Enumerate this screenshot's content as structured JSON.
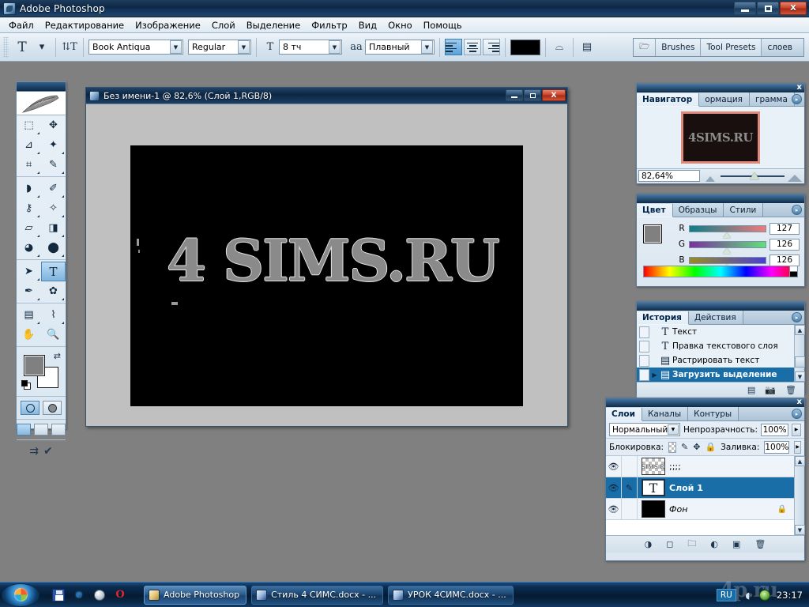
{
  "app": {
    "title": "Adobe Photoshop",
    "icon": "photoshop-icon"
  },
  "window_buttons": {
    "minimize": "minimize-icon",
    "restore": "restore-icon",
    "close": "X"
  },
  "menubar": {
    "items": [
      "Файл",
      "Редактирование",
      "Изображение",
      "Слой",
      "Выделение",
      "Фильтр",
      "Вид",
      "Окно",
      "Помощь"
    ]
  },
  "options_bar": {
    "tool_glyph": "T",
    "tool_preset_arrow": "▾",
    "orientation_icon": "text-orientation-icon",
    "font_family": "Book Antiqua",
    "font_style": "Regular",
    "size_icon": "font-size-icon",
    "font_size": "8 тч",
    "aa_icon": "anti-alias-icon",
    "anti_alias": "Плавный",
    "align": {
      "left": "align-left",
      "center": "align-center",
      "right": "align-right",
      "active": "left"
    },
    "text_color": "#000000",
    "warp_icon": "warp-text-icon",
    "panels_icon": "character-panel-icon",
    "palette_well": {
      "dock_icon": "file-browser-icon",
      "tabs": [
        "Brushes",
        "Tool Presets",
        "слоев"
      ]
    }
  },
  "toolbox": {
    "logo": "feather-logo",
    "tools": [
      {
        "name": "rectangular-marquee",
        "glyph": "⬚",
        "submenu": false
      },
      {
        "name": "move-tool",
        "glyph": "➤",
        "submenu": false
      },
      {
        "name": "lasso-tool",
        "glyph": "◁",
        "submenu": true
      },
      {
        "name": "magic-wand",
        "glyph": "✳",
        "submenu": true
      },
      {
        "name": "crop-tool",
        "glyph": "⌗",
        "submenu": true
      },
      {
        "name": "slice-tool",
        "glyph": "✎",
        "submenu": true
      },
      {
        "name": "healing-brush",
        "glyph": "✚",
        "submenu": true
      },
      {
        "name": "brush-tool",
        "glyph": "✒",
        "submenu": true
      },
      {
        "name": "clone-stamp",
        "glyph": "♆",
        "submenu": true
      },
      {
        "name": "history-brush",
        "glyph": "✧",
        "submenu": true
      },
      {
        "name": "eraser-tool",
        "glyph": "▰",
        "submenu": true
      },
      {
        "name": "gradient-tool",
        "glyph": "◨",
        "submenu": true
      },
      {
        "name": "blur-tool",
        "glyph": "💧",
        "submenu": true
      },
      {
        "name": "dodge-tool",
        "glyph": "●",
        "submenu": true
      },
      {
        "name": "path-selection",
        "glyph": "➤",
        "submenu": true
      },
      {
        "name": "type-tool",
        "glyph": "T",
        "submenu": true,
        "selected": true
      },
      {
        "name": "pen-tool",
        "glyph": "✑",
        "submenu": true
      },
      {
        "name": "custom-shape",
        "glyph": "✦",
        "submenu": true
      },
      {
        "name": "notes-tool",
        "glyph": "▤",
        "submenu": true
      },
      {
        "name": "eyedropper-tool",
        "glyph": "⌁",
        "submenu": true
      },
      {
        "name": "hand-tool",
        "glyph": "✋",
        "submenu": false
      },
      {
        "name": "zoom-tool",
        "glyph": "🔍",
        "submenu": false
      }
    ],
    "foreground_color": "#808080",
    "background_color": "#ffffff",
    "swap_icon": "↰",
    "quickmask": [
      "standard-mode",
      "quick-mask-mode"
    ],
    "screenmodes": [
      "standard-screen",
      "full-screen-menubar",
      "full-screen"
    ],
    "jump_to": [
      "jump-to-imageready",
      "jump-to-validate"
    ]
  },
  "document": {
    "title": "Без имени-1 @ 82,6% (Слой 1,RGB/8)",
    "canvas_text": "4 SIMS.RU",
    "canvas_bg": "#000000",
    "text_color": "#8a8a8a"
  },
  "navigator": {
    "tabs": [
      "Навигатор",
      "ормация",
      "грамма"
    ],
    "active_tab": "Навигатор",
    "thumb_text": "4SIMS.RU",
    "zoom": "82,64%",
    "zoom_out_icon": "zoom-out-icon",
    "zoom_in_icon": "zoom-in-icon"
  },
  "color_panel": {
    "tabs": [
      "Цвет",
      "Образцы",
      "Стили"
    ],
    "active_tab": "Цвет",
    "foreground": "#808080",
    "background": "#ffffff",
    "channels": [
      {
        "label": "R",
        "value": "127"
      },
      {
        "label": "G",
        "value": "126"
      },
      {
        "label": "B",
        "value": "126"
      }
    ]
  },
  "history_panel": {
    "tabs": [
      "История",
      "Действия"
    ],
    "active_tab": "История",
    "items": [
      {
        "label": "Текст",
        "icon": "type-icon",
        "selected": false
      },
      {
        "label": "Правка текстового слоя",
        "icon": "type-icon",
        "selected": false
      },
      {
        "label": "Растрировать текст",
        "icon": "rasterize-icon",
        "selected": false
      },
      {
        "label": "Загрузить выделение",
        "icon": "rasterize-icon",
        "selected": true
      }
    ],
    "footer_icons": [
      "new-document-from-state",
      "new-snapshot",
      "delete-state"
    ]
  },
  "layers_panel": {
    "tabs": [
      "Слои",
      "Каналы",
      "Контуры"
    ],
    "active_tab": "Слои",
    "blend_mode": "Нормальный",
    "opacity_label": "Непрозрачность:",
    "opacity_value": "100%",
    "lock_label": "Блокировка:",
    "lock_icons": [
      "lock-transparency",
      "lock-image",
      "lock-position",
      "lock-all"
    ],
    "fill_label": "Заливка:",
    "fill_value": "100%",
    "layers": [
      {
        "name": ";;;;",
        "thumb": "checker",
        "thumb_text": "4SIMS.RU",
        "visible": true,
        "linked": false,
        "selected": false,
        "locked": false,
        "italic": false
      },
      {
        "name": "Слой 1",
        "thumb": "type",
        "thumb_text": "T",
        "visible": true,
        "linked": true,
        "selected": true,
        "locked": false,
        "italic": false
      },
      {
        "name": "Фон",
        "thumb": "black",
        "thumb_text": "",
        "visible": true,
        "linked": false,
        "selected": false,
        "locked": true,
        "italic": true
      }
    ],
    "footer_icons": [
      "layer-style",
      "layer-mask",
      "new-group",
      "adjustment-layer",
      "new-layer",
      "delete-layer"
    ]
  },
  "taskbar": {
    "start": "windows-orb",
    "quicklaunch": [
      "save-icon",
      "internet-explorer-icon",
      "globe-icon",
      "opera-icon"
    ],
    "tasks": [
      {
        "label": "Adobe Photoshop",
        "icon": "photoshop-icon",
        "active": true
      },
      {
        "label": "Стиль 4 СИМС.docx - ...",
        "icon": "word-icon",
        "active": false
      },
      {
        "label": "УРОК 4СИМС.docx - ...",
        "icon": "word-icon",
        "active": false
      }
    ],
    "tray": {
      "language": "RU",
      "icons": [
        "network-icon",
        "security-icon"
      ],
      "clock": "23:17"
    },
    "watermark": "4p.ru"
  }
}
